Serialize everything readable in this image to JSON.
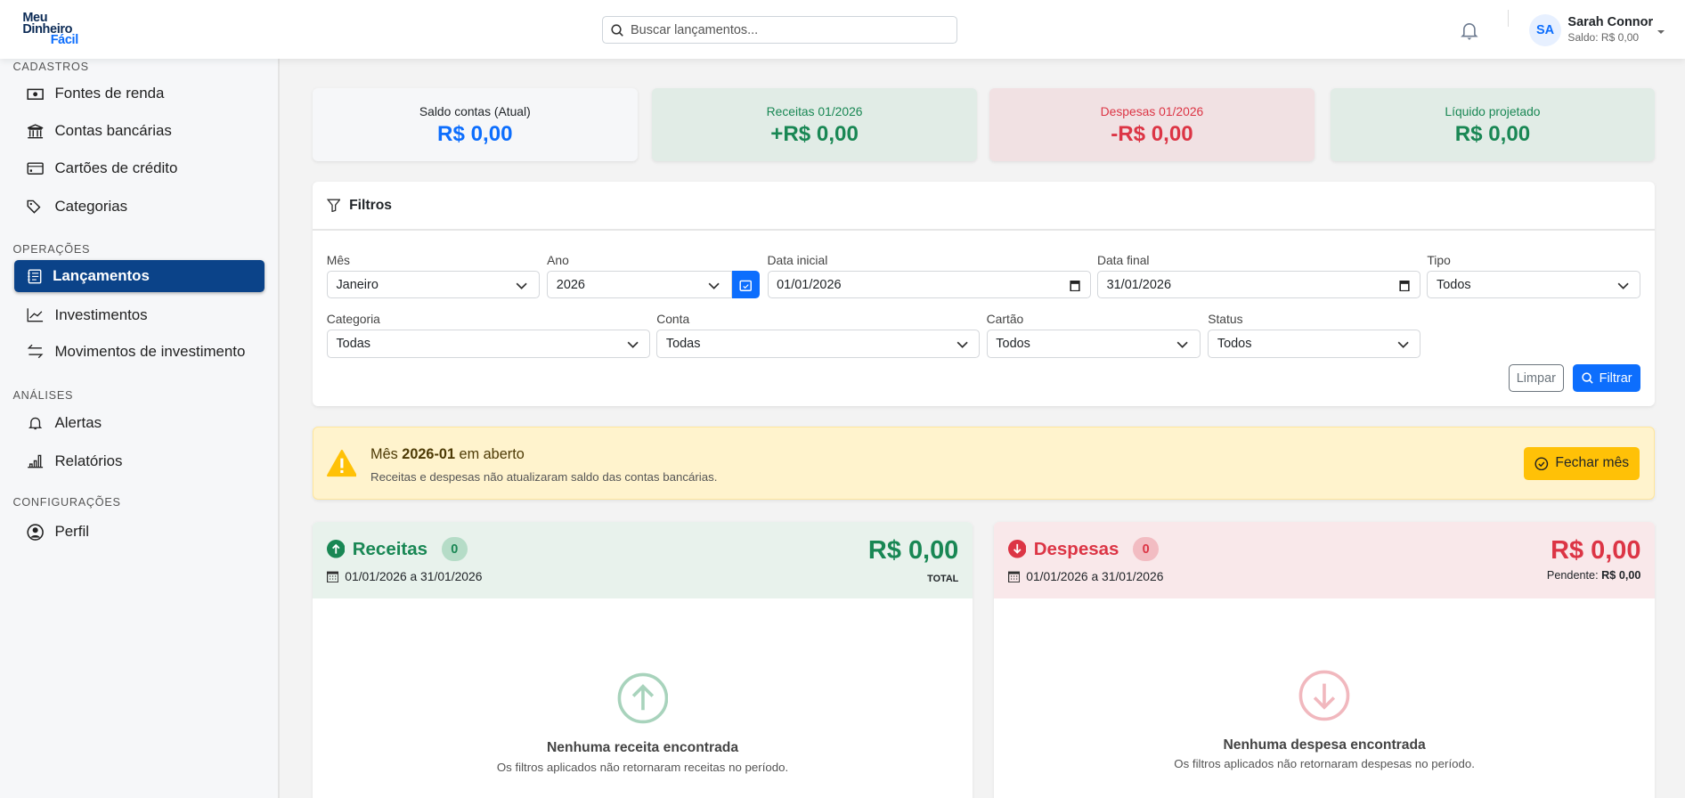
{
  "app": {
    "logo": [
      "Meu",
      "Dinheiro",
      "Fácil"
    ]
  },
  "header": {
    "search_placeholder": "Buscar lançamentos...",
    "user_name": "Sarah Connor",
    "user_initials": "SA",
    "user_balance": "Saldo: R$ 0,00"
  },
  "sidebar": {
    "sections": [
      "CADASTROS",
      "OPERAÇÕES",
      "ANÁLISES",
      "CONFIGURAÇÕES"
    ],
    "items": [
      {
        "label": "Fontes de renda"
      },
      {
        "label": "Contas bancárias"
      },
      {
        "label": "Cartões de crédito"
      },
      {
        "label": "Categorias"
      },
      {
        "label": "Lançamentos"
      },
      {
        "label": "Investimentos"
      },
      {
        "label": "Movimentos de investimento"
      },
      {
        "label": "Alertas"
      },
      {
        "label": "Relatórios"
      },
      {
        "label": "Perfil"
      }
    ]
  },
  "summary": [
    {
      "label": "Saldo contas (Atual)",
      "value": "R$ 0,00",
      "color": "#0d6efd"
    },
    {
      "label": "Receitas 01/2026",
      "value": "+R$ 0,00",
      "color": "#198754"
    },
    {
      "label": "Despesas 01/2026",
      "value": "-R$ 0,00",
      "color": "#dc3545"
    },
    {
      "label": "Líquido projetado",
      "value": "R$ 0,00",
      "color": "#198754"
    }
  ],
  "filters": {
    "title": "Filtros",
    "mes": {
      "label": "Mês",
      "value": "Janeiro"
    },
    "ano": {
      "label": "Ano",
      "value": "2026"
    },
    "data_inicial": {
      "label": "Data inicial",
      "value": "01/01/2026"
    },
    "data_final": {
      "label": "Data final",
      "value": "31/01/2026"
    },
    "tipo": {
      "label": "Tipo",
      "value": "Todos"
    },
    "categoria": {
      "label": "Categoria",
      "value": "Todas"
    },
    "conta": {
      "label": "Conta",
      "value": "Todas"
    },
    "cartao": {
      "label": "Cartão",
      "value": "Todos"
    },
    "status": {
      "label": "Status",
      "value": "Todos"
    },
    "clear_label": "Limpar",
    "filter_label": "Filtrar"
  },
  "alert": {
    "prefix": "Mês ",
    "month": "2026-01",
    "suffix": " em aberto",
    "message": "Receitas e despesas não atualizaram saldo das contas bancárias.",
    "button": "Fechar mês"
  },
  "receitas": {
    "title": "Receitas",
    "count": "0",
    "range": "01/01/2026 a 31/01/2026",
    "amount": "R$ 0,00",
    "total_label": "TOTAL",
    "empty_title": "Nenhuma receita encontrada",
    "empty_text": "Os filtros aplicados não retornaram receitas no período."
  },
  "despesas": {
    "title": "Despesas",
    "count": "0",
    "range": "01/01/2026 a 31/01/2026",
    "amount": "R$ 0,00",
    "pending_label": "Pendente: ",
    "pending_value": "R$ 0,00",
    "empty_title": "Nenhuma despesa encontrada",
    "empty_text": "Os filtros aplicados não retornaram despesas no período."
  }
}
